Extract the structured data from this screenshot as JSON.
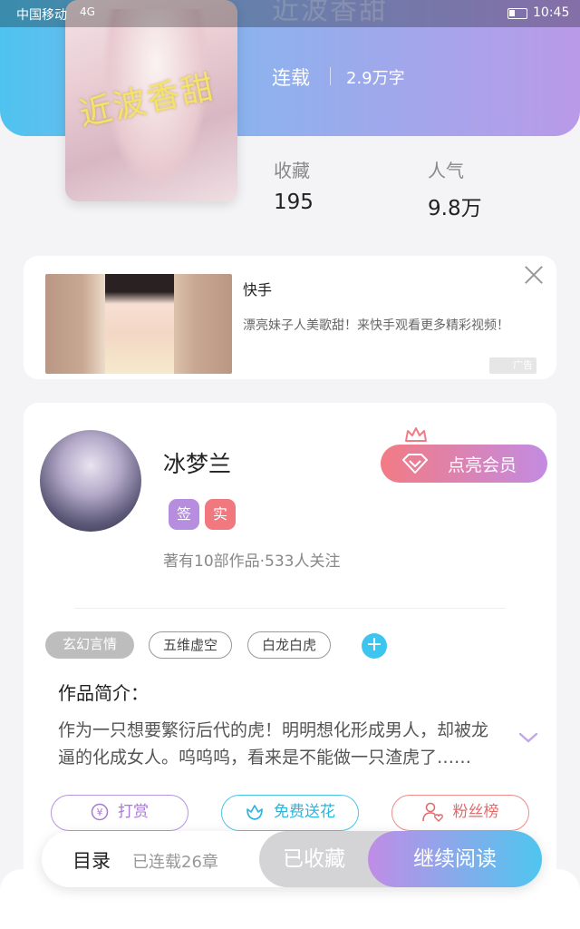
{
  "status_bar": {
    "carrier": "中国移动",
    "network": "4G",
    "time": "10:45"
  },
  "book": {
    "title_faded": "近波香甜",
    "cover_text": "近波香甜",
    "serial_status": "连载",
    "word_count": "2.9万字",
    "stats": [
      {
        "label": "收藏",
        "value": "195"
      },
      {
        "label": "人气",
        "value": "9.8万"
      }
    ]
  },
  "ad": {
    "title": "快手",
    "description": "漂亮妹子人美歌甜！来快手观看更多精彩视频！",
    "badge": "广告"
  },
  "author": {
    "name": "冰梦兰",
    "badges": [
      "签",
      "实"
    ],
    "meta": "著有10部作品·533人关注",
    "vip_button": "点亮会员"
  },
  "tags": [
    "玄幻言情",
    "五维虚空",
    "白龙白虎"
  ],
  "intro": {
    "title": "作品简介：",
    "text": "作为一只想要繁衍后代的虎！明明想化形成男人，却被龙逼的化成女人。呜呜呜，看来是不能做一只渣虎了……"
  },
  "actions": {
    "reward": "打赏",
    "flower": "免费送花",
    "fans": "粉丝榜"
  },
  "bottom_bar": {
    "toc": "目录",
    "chapter_count": "已连载26章",
    "collected": "已收藏",
    "continue": "继续阅读"
  },
  "colors": {
    "accent_blue": "#4fc3ef",
    "accent_purple": "#b99ae8",
    "vip_pink": "#f27b84"
  }
}
